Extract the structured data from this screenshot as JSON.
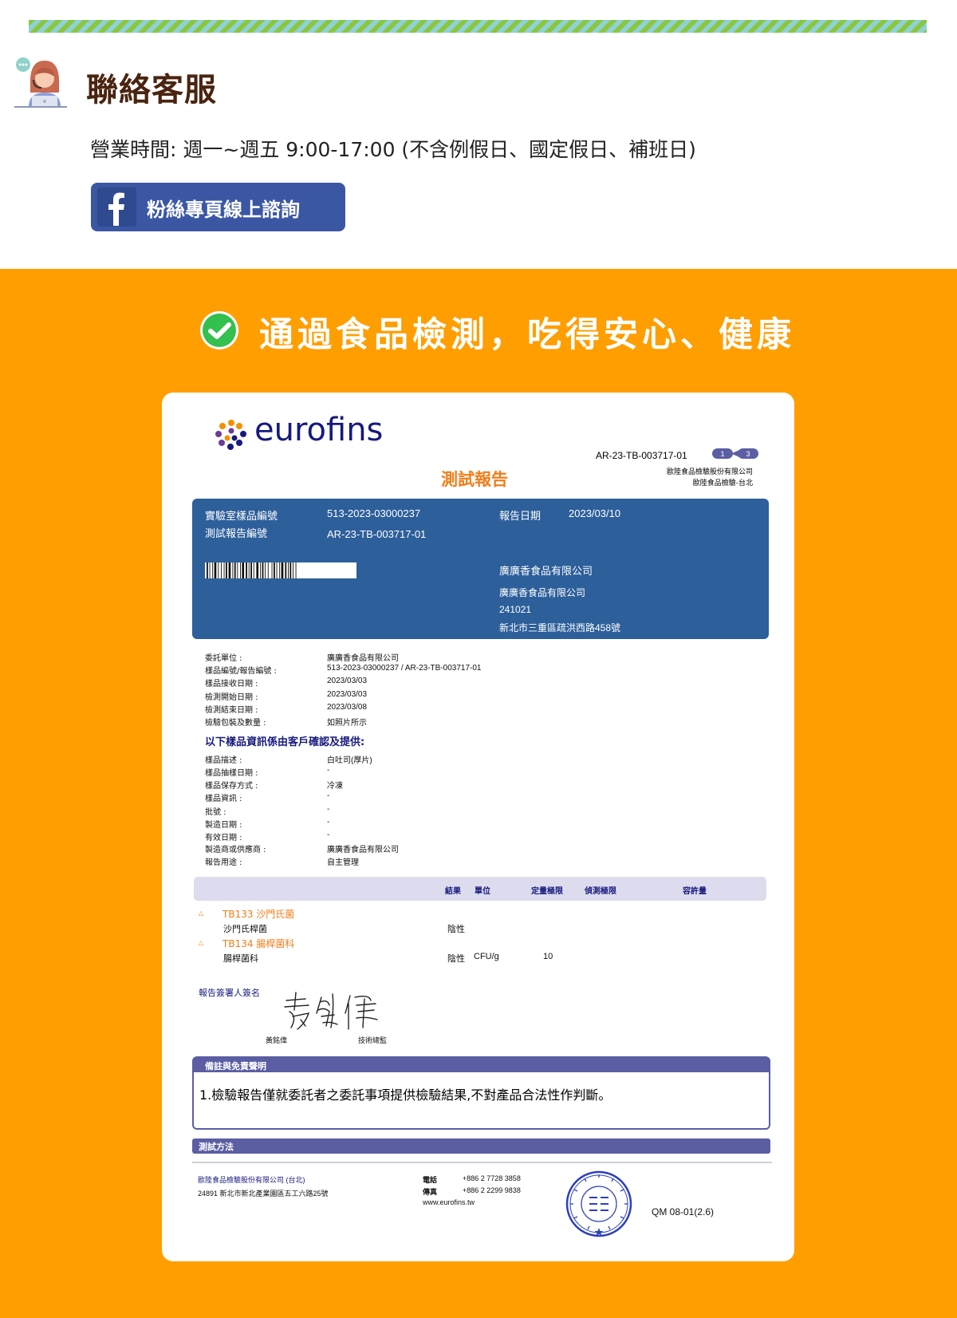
{
  "contact": {
    "title": "聯絡客服",
    "hours": "營業時間:  週一~週五 9:00-17:00  (不含例假日、國定假日、補班日)",
    "fb_button_label": "粉絲專頁線上諮詢"
  },
  "headline": "通過食品檢測，吃得安心、健康",
  "report": {
    "brand": "eurofins",
    "report_number": "AR-23-TB-003717-01",
    "page_indicator": {
      "current": "1",
      "total": "3"
    },
    "lab_company_line1": "歐陸食品檢驗股份有限公司",
    "lab_company_line2": "歐陸食品檢驗-台北",
    "title": "測試報告",
    "info": {
      "sample_no_label": "實驗室樣品編號",
      "sample_no": "513-2023-03000237",
      "report_no_label": "測試報告編號",
      "report_no": "AR-23-TB-003717-01",
      "report_date_label": "報告日期",
      "report_date": "2023/03/10",
      "client_name": "廣廣香食品有限公司",
      "client_name2": "廣廣香食品有限公司",
      "postcode": "241021",
      "address": "新北市三重區疏洪西路458號"
    },
    "details": [
      {
        "label": "委託單位 :",
        "value": "廣廣香食品有限公司"
      },
      {
        "label": "樣品編號/報告編號 :",
        "value": "513-2023-03000237   /  AR-23-TB-003717-01"
      },
      {
        "label": "樣品接收日期 :",
        "value": "2023/03/03"
      },
      {
        "label": "檢測開始日期 :",
        "value": "2023/03/03"
      },
      {
        "label": "檢測結束日期 :",
        "value": "2023/03/08"
      },
      {
        "label": "檢驗包裝及數量 :",
        "value": "如照片所示"
      }
    ],
    "client_info_heading": "以下樣品資訊係由客戶確認及提供:",
    "client_info": [
      {
        "label": "樣品描述 :",
        "value": "白吐司(厚片)"
      },
      {
        "label": "樣品抽樣日期 :",
        "value": "-"
      },
      {
        "label": "樣品保存方式 :",
        "value": "冷凍"
      },
      {
        "label": "樣品資訊 :",
        "value": "-"
      },
      {
        "label": "批號 :",
        "value": "-"
      },
      {
        "label": "製造日期 :",
        "value": "-"
      },
      {
        "label": "有效日期 :",
        "value": "-"
      },
      {
        "label": "製造商或供應商 :",
        "value": "廣廣香食品有限公司"
      },
      {
        "label": "報告用途 :",
        "value": "自主管理"
      }
    ],
    "results_columns": {
      "result": "結果",
      "unit": "單位",
      "loq": "定量極限",
      "lod": "偵測極限",
      "limit": "容許量"
    },
    "tests": [
      {
        "marker": "△",
        "code": "TB133  沙門氏菌",
        "analyte": "沙門氏桿菌",
        "result": "陰性",
        "unit": "",
        "loq": ""
      },
      {
        "marker": "△",
        "code": "TB134  腸桿菌科",
        "analyte": "腸桿菌科",
        "result": "陰性",
        "unit": "CFU/g",
        "loq": "10"
      }
    ],
    "signer_label": "報告簽署人簽名",
    "signer_name": "黃銘偉",
    "signer_role": "技術總監",
    "remarks_title": "備註與免責聲明",
    "remarks_text": "1.檢驗報告僅就委託者之委託事項提供檢驗結果,不對產品合法性作判斷。",
    "methods_title": "測試方法",
    "footer": {
      "lab_name": "歐陸食品檢驗股份有限公司 (台北)",
      "lab_address": "24891 新北市新北產業園區五工六路25號",
      "tel_label": "電話",
      "tel": "+886 2 7728 3858",
      "fax_label": "傳真",
      "fax": "+886 2 2299 9838",
      "website": "www.eurofins.tw",
      "form_code": "QM 08-01(2.6)"
    }
  },
  "colors": {
    "orange": "#ff9e00",
    "facebook_blue": "#3b57a4",
    "report_blue": "#2d5f9a",
    "eurofins_navy": "#17197d",
    "accent_orange": "#f07e1a"
  },
  "icons": {
    "agent": "customer-service-agent-icon",
    "facebook": "facebook-icon",
    "check": "check-circle-icon"
  }
}
